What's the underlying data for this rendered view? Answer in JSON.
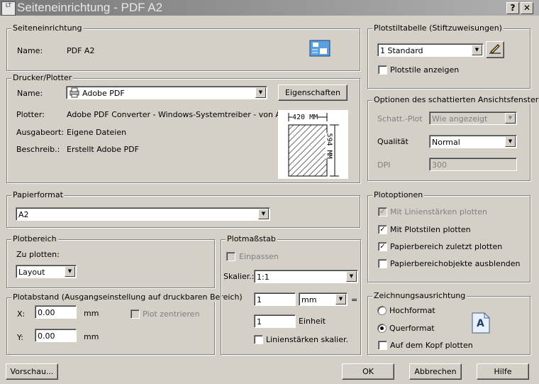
{
  "window": {
    "title": "Seiteneinrichtung - PDF A2",
    "help_btn": "?",
    "close_btn": "✕",
    "app_icon_text": "LT"
  },
  "page_setup": {
    "legend": "Seiteneinrichtung",
    "name_label": "Name:",
    "name_value": "PDF A2"
  },
  "printer": {
    "legend": "Drucker/Plotter",
    "name_label": "Name:",
    "name_value": "Adobe PDF",
    "properties_btn": "Eigenschaften",
    "plotter_label": "Plotter:",
    "plotter_value": "Adobe PDF Converter - Windows-Systemtreiber - von Au...",
    "location_label": "Ausgabeort:",
    "location_value": "Eigene Dateien",
    "desc_label": "Beschreib.:",
    "desc_value": "Erstellt Adobe PDF",
    "preview_width": "420 MM",
    "preview_height": "594 MM"
  },
  "paper": {
    "legend": "Papierformat",
    "value": "A2"
  },
  "plot_area": {
    "legend": "Plotbereich",
    "label": "Zu plotten:",
    "value": "Layout"
  },
  "offset": {
    "legend": "Plotabstand (Ausgangseinstellung auf druckbaren Bereich)",
    "x_label": "X:",
    "x_value": "0.00",
    "x_unit": "mm",
    "y_label": "Y:",
    "y_value": "0.00",
    "y_unit": "mm",
    "center_label": "Plot zentrieren"
  },
  "scale": {
    "legend": "Plotmaßstab",
    "fit_label": "Einpassen",
    "scale_label": "Skalier.:",
    "scale_value": "1:1",
    "mm_value": "1",
    "mm_unit": "mm",
    "equals": "=",
    "unit_value": "1",
    "unit_label": "Einheit",
    "lineweight_label": "Linienstärken skalier."
  },
  "style_table": {
    "legend": "Plotstiltabelle (Stiftzuweisungen)",
    "value": "1 Standard",
    "show_label": "Plotstile anzeigen"
  },
  "shaded": {
    "legend": "Optionen des schattierten Ansichtsfensters",
    "shade_label": "Schatt.-Plot",
    "shade_value": "Wie angezeigt",
    "quality_label": "Qualität",
    "quality_value": "Normal",
    "dpi_label": "DPI",
    "dpi_value": "300"
  },
  "plot_options": {
    "legend": "Plotoptionen",
    "items": [
      {
        "label": "Mit Linienstärken plotten",
        "checked": true,
        "disabled": true
      },
      {
        "label": "Mit Plotstilen plotten",
        "checked": true,
        "disabled": false
      },
      {
        "label": "Papierbereich zuletzt plotten",
        "checked": true,
        "disabled": false
      },
      {
        "label": "Papierbereichobjekte ausblenden",
        "checked": false,
        "disabled": false
      }
    ]
  },
  "orientation": {
    "legend": "Zeichnungsausrichtung",
    "portrait": "Hochformat",
    "landscape": "Querformat",
    "upside_down": "Auf dem Kopf plotten",
    "selected": "landscape",
    "icon_letter": "A"
  },
  "footer": {
    "preview": "Vorschau...",
    "ok": "OK",
    "cancel": "Abbrechen",
    "help": "Hilfe"
  }
}
